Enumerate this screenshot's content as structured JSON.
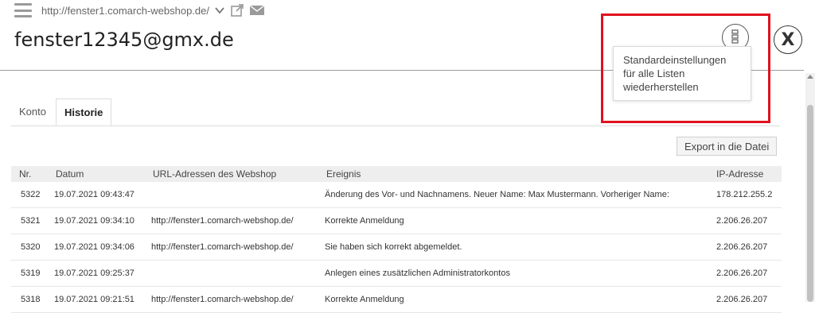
{
  "header": {
    "url": "http://fenster1.comarch-webshop.de/",
    "title": "fenster12345@gmx.de"
  },
  "tooltip": {
    "lines": [
      "Standardeinstellungen",
      "für alle Listen",
      "wiederherstellen"
    ]
  },
  "tabs": [
    {
      "label": "Konto",
      "active": false
    },
    {
      "label": "Historie",
      "active": true
    }
  ],
  "toolbar": {
    "export_label": "Export in die Datei"
  },
  "table": {
    "columns": [
      "Nr.",
      "Datum",
      "URL-Adressen des Webshop",
      "Ereignis",
      "IP-Adresse"
    ],
    "rows": [
      {
        "nr": "5322",
        "date": "19.07.2021 09:43:47",
        "url": "",
        "event": "Änderung des Vor- und Nachnamens. Neuer Name: Max Mustermann. Vorheriger Name:",
        "ip": "178.212.255.2"
      },
      {
        "nr": "5321",
        "date": "19.07.2021 09:34:10",
        "url": "http://fenster1.comarch-webshop.de/",
        "event": "Korrekte Anmeldung",
        "ip": "2.206.26.207"
      },
      {
        "nr": "5320",
        "date": "19.07.2021 09:34:06",
        "url": "http://fenster1.comarch-webshop.de/",
        "event": "Sie haben sich korrekt abgemeldet.",
        "ip": "2.206.26.207"
      },
      {
        "nr": "5319",
        "date": "19.07.2021 09:25:37",
        "url": "",
        "event": "Anlegen eines zusätzlichen Administratorkontos",
        "ip": "2.206.26.207"
      },
      {
        "nr": "5318",
        "date": "19.07.2021 09:21:51",
        "url": "http://fenster1.comarch-webshop.de/",
        "event": "Korrekte Anmeldung",
        "ip": "2.206.26.207"
      }
    ]
  },
  "icons": {
    "menu": "hamburger-menu-icon",
    "dropdown": "chevron-down-icon",
    "external": "external-link-icon",
    "mail": "envelope-icon",
    "reset": "reset-list-settings-icon",
    "close": "close-icon"
  },
  "colors": {
    "highlight": "#e0121f",
    "header_bg": "#eeeeee",
    "text": "#333333"
  }
}
